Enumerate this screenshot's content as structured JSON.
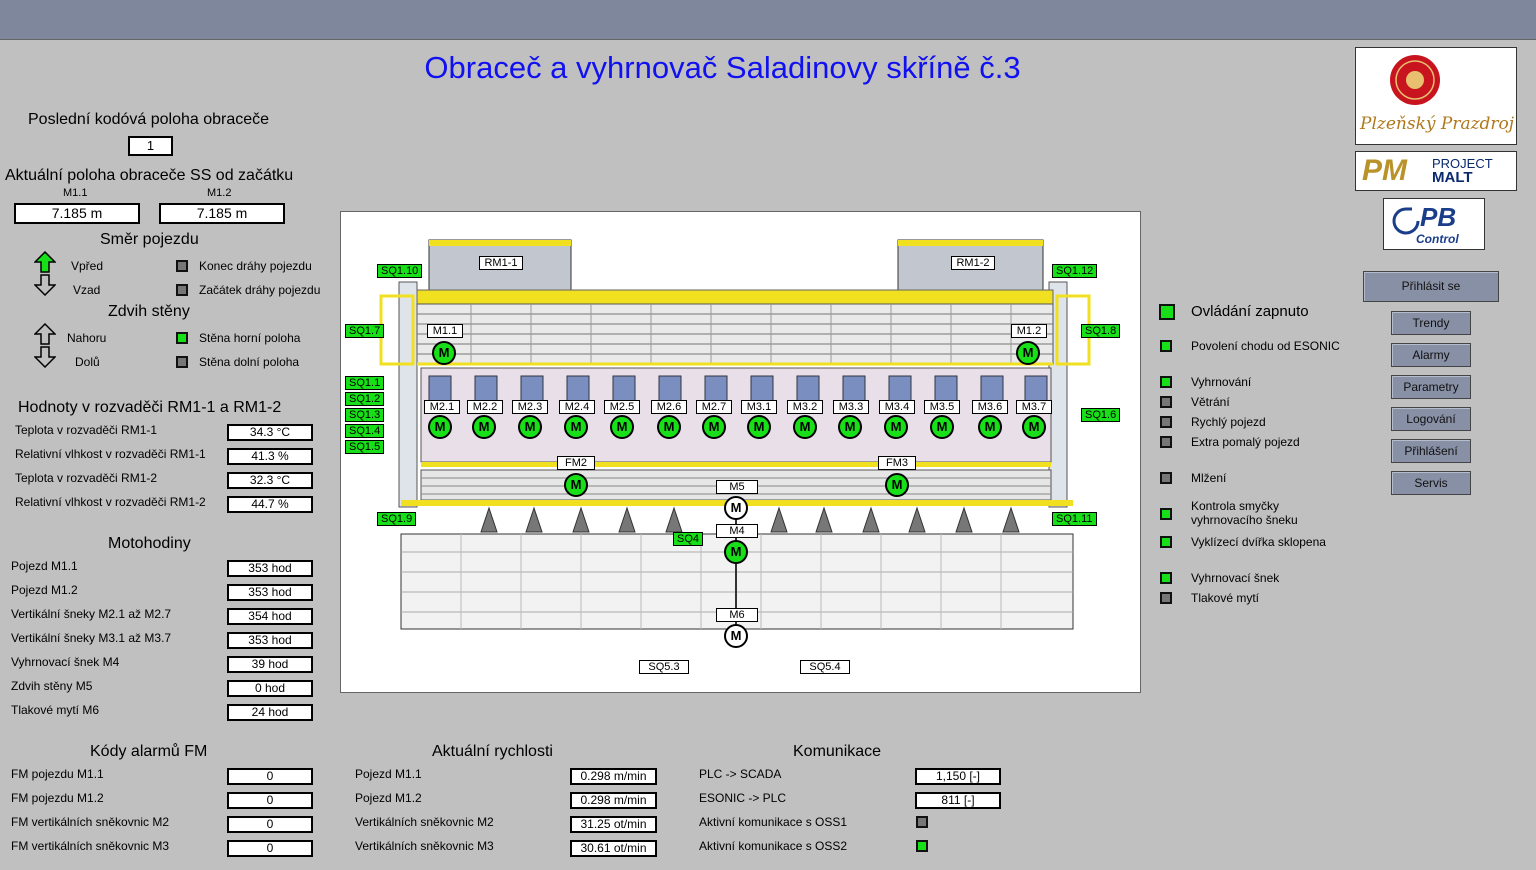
{
  "title": "Obraceč a vyhrnovač Saladinovy skříně č.3",
  "position": {
    "last_code_label": "Poslední kodóvá poloha obraceče",
    "last_code_value": "1",
    "current_label": "Aktuální poloha obraceče SS od začátku",
    "m11_label": "M1.1",
    "m12_label": "M1.2",
    "m11_value": "7.185 m",
    "m12_value": "7.185 m"
  },
  "travel": {
    "heading": "Směr pojezdu",
    "forward": "Vpřed",
    "backward": "Vzad",
    "end_label": "Konec dráhy pojezdu",
    "start_label": "Začátek dráhy pojezdu"
  },
  "lift": {
    "heading": "Zdvih stěny",
    "up": "Nahoru",
    "down": "Dolů",
    "top_label": "Stěna horní poloha",
    "bottom_label": "Stěna dolní poloha"
  },
  "cabinet": {
    "heading": "Hodnoty v rozvaděči RM1-1 a RM1-2",
    "rows": [
      {
        "label": "Teplota v rozvaděči RM1-1",
        "value": "34.3 °C"
      },
      {
        "label": "Relativní vlhkost v rozvaděči RM1-1",
        "value": "41.3 %"
      },
      {
        "label": "Teplota v rozvaděči RM1-2",
        "value": "32.3 °C"
      },
      {
        "label": "Relativní vlhkost v rozvaděči RM1-2",
        "value": "44.7 %"
      }
    ]
  },
  "hours": {
    "heading": "Motohodiny",
    "rows": [
      {
        "label": "Pojezd M1.1",
        "value": "353 hod"
      },
      {
        "label": "Pojezd M1.2",
        "value": "353 hod"
      },
      {
        "label": "Vertikální šneky M2.1 až M2.7",
        "value": "354 hod"
      },
      {
        "label": "Vertikální šneky M3.1 až M3.7",
        "value": "353 hod"
      },
      {
        "label": "Vyhrnovací šnek M4",
        "value": "39 hod"
      },
      {
        "label": "Zdvih stěny M5",
        "value": "0 hod"
      },
      {
        "label": "Tlakové mytí M6",
        "value": "24 hod"
      }
    ]
  },
  "alarms": {
    "heading": "Kódy alarmů FM",
    "rows": [
      {
        "label": "FM pojezdu M1.1",
        "value": "0"
      },
      {
        "label": "FM pojezdu M1.2",
        "value": "0"
      },
      {
        "label": "FM vertikálních sněkovnic M2",
        "value": "0"
      },
      {
        "label": "FM vertikálních sněkovnic M3",
        "value": "0"
      }
    ]
  },
  "speeds": {
    "heading": "Aktuální rychlosti",
    "rows": [
      {
        "label": "Pojezd M1.1",
        "value": "0.298 m/min"
      },
      {
        "label": "Pojezd M1.2",
        "value": "0.298 m/min"
      },
      {
        "label": "Vertikálních sněkovnic M2",
        "value": "31.25 ot/min"
      },
      {
        "label": "Vertikálních sněkovnic M3",
        "value": "30.61 ot/min"
      }
    ]
  },
  "comms": {
    "heading": "Komunikace",
    "plc_label": "PLC -> SCADA",
    "plc_value": "1,150 [-]",
    "esonic_label": "ESONIC -> PLC",
    "esonic_value": "811 [-]",
    "oss1_label": "Aktivní komunikace s OSS1",
    "oss2_label": "Aktivní komunikace s OSS2"
  },
  "status": {
    "control_on": "Ovládání zapnuto",
    "esonic_permit": "Povolení chodu od ESONIC",
    "items": [
      {
        "label": "Vyhrnování",
        "on": true
      },
      {
        "label": "Větrání",
        "on": false
      },
      {
        "label": "Rychlý pojezd",
        "on": false
      },
      {
        "label": "Extra pomalý pojezd",
        "on": false
      },
      {
        "label": "Mlžení",
        "on": false
      },
      {
        "label": "Kontrola smyčky vyhrnovacího šneku",
        "on": true
      },
      {
        "label": "Vyklízecí dvířka sklopena",
        "on": true
      },
      {
        "label": "Vyhrnovací šnek",
        "on": true
      },
      {
        "label": "Tlakové mytí",
        "on": false
      }
    ]
  },
  "buttons": {
    "login": "Přihlásit se",
    "trends": "Trendy",
    "alarms": "Alarmy",
    "params": "Parametry",
    "logging": "Logování",
    "logins": "Přihlášení",
    "service": "Servis"
  },
  "logos": {
    "pp_text": "Plzeňský Prazdroj",
    "pm_big": "PM",
    "pm_small1": "PROJECT",
    "pm_small2": "MALT",
    "pb_big": "PB",
    "pb_small": "Control"
  },
  "diagram": {
    "rm11": "RM1-1",
    "rm12": "RM1-2",
    "m11": "M1.1",
    "m12": "M1.2",
    "fm2": "FM2",
    "fm3": "FM3",
    "m5": "M5",
    "m4": "M4",
    "m6": "M6",
    "motor_letter": "M",
    "motors": [
      "M2.1",
      "M2.2",
      "M2.3",
      "M2.4",
      "M2.5",
      "M2.6",
      "M2.7",
      "M3.1",
      "M3.2",
      "M3.3",
      "M3.4",
      "M3.5",
      "M3.6",
      "M3.7"
    ],
    "sensors_left": [
      "SQ1.10",
      "SQ1.7",
      "SQ1.1",
      "SQ1.2",
      "SQ1.3",
      "SQ1.4",
      "SQ1.5",
      "SQ1.9"
    ],
    "sensors_right": [
      "SQ1.12",
      "SQ1.8",
      "SQ1.6",
      "SQ1.11"
    ],
    "sq4": "SQ4",
    "sq53": "SQ5.3",
    "sq54": "SQ5.4"
  },
  "colors": {
    "accent_green": "#18e018",
    "title_blue": "#1010f0",
    "background": "#c0c0c0"
  }
}
